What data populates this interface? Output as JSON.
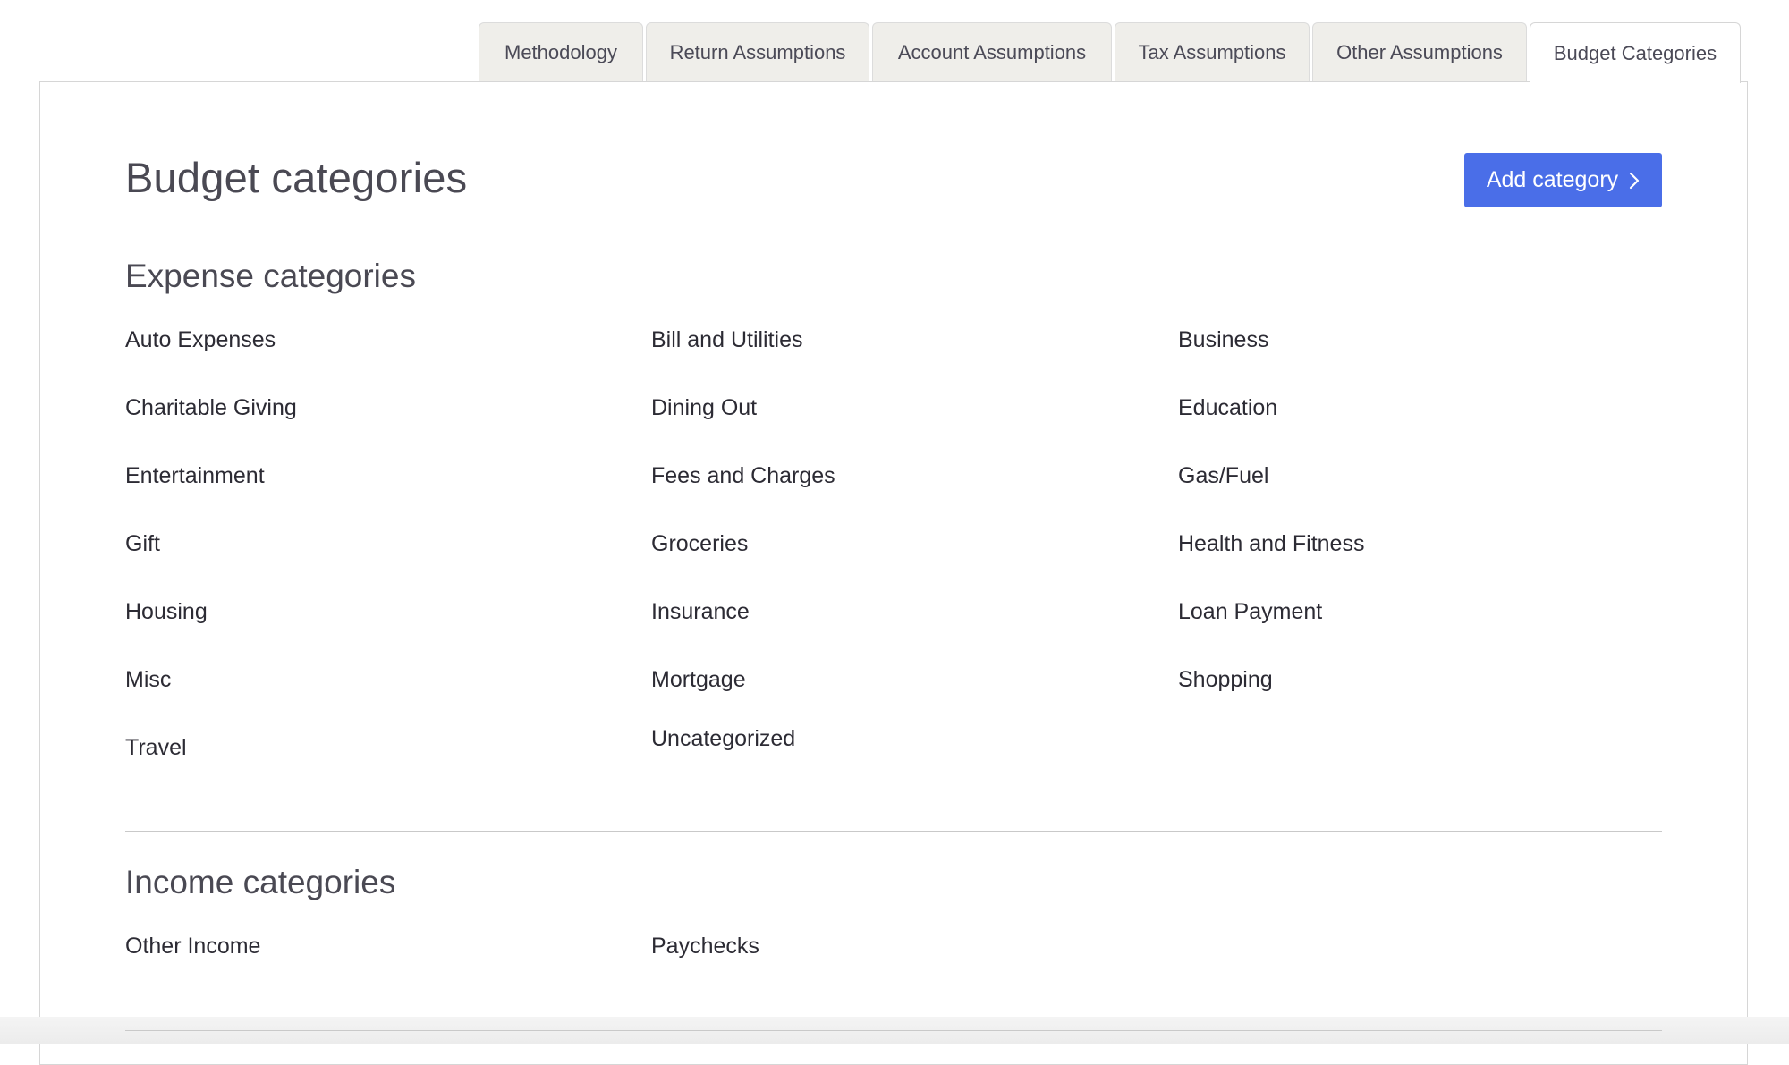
{
  "tabs": [
    {
      "label": "Methodology",
      "active": false
    },
    {
      "label": "Return Assumptions",
      "active": false
    },
    {
      "label": "Account Assumptions",
      "active": false
    },
    {
      "label": "Tax Assumptions",
      "active": false
    },
    {
      "label": "Other Assumptions",
      "active": false
    },
    {
      "label": "Budget Categories",
      "active": true
    }
  ],
  "page": {
    "title": "Budget categories",
    "add_button_label": "Add category",
    "add_button_icon": "chevron-right-icon",
    "accent_color": "#4a6ee8"
  },
  "expense": {
    "title": "Expense categories",
    "items": [
      "Auto Expenses",
      "Bill and Utilities",
      "Business",
      "Charitable Giving",
      "Dining Out",
      "Education",
      "Entertainment",
      "Fees and Charges",
      "Gas/Fuel",
      "Gift",
      "Groceries",
      "Health and Fitness",
      "Housing",
      "Insurance",
      "Loan Payment",
      "Misc",
      "Mortgage",
      "Shopping",
      "Travel",
      "Uncategorized"
    ]
  },
  "income": {
    "title": "Income categories",
    "items": [
      "Other Income",
      "Paychecks"
    ]
  }
}
